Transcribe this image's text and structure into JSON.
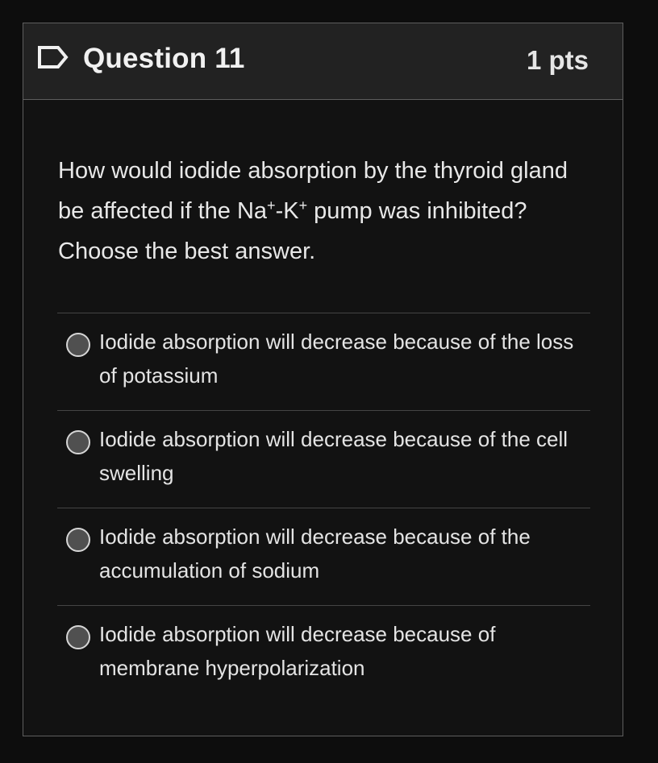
{
  "question": {
    "title": "Question 11",
    "points": "1 pts",
    "text_part1": "How would iodide absorption by the thyroid gland be affected if the Na",
    "sup1": "+",
    "text_part2": "-K",
    "sup2": "+",
    "text_part3": " pump was inhibited? Choose the best answer."
  },
  "answers": [
    {
      "label": "Iodide absorption will decrease because of the loss of potassium",
      "selected": false
    },
    {
      "label": "Iodide absorption will decrease because of the cell swelling",
      "selected": false
    },
    {
      "label": "Iodide absorption will decrease because of the accumulation of sodium",
      "selected": false
    },
    {
      "label": "Iodide absorption will decrease because of membrane hyperpolarization",
      "selected": false
    }
  ],
  "icons": {
    "flag": "flag-question-icon",
    "radio": "radio-unselected-icon"
  },
  "colors": {
    "background": "#0d0d0d",
    "card": "#121212",
    "header": "#222222",
    "border": "#5e5e5e"
  }
}
